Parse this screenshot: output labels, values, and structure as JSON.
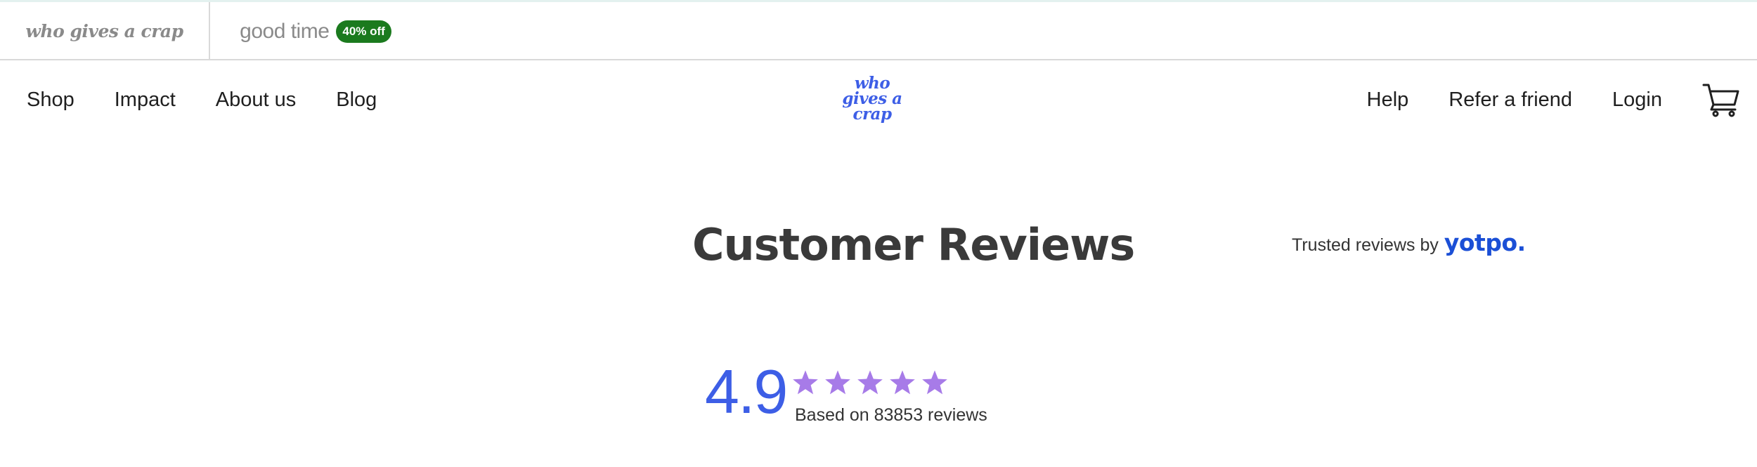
{
  "brand_strip": {
    "tabs": [
      {
        "label": "who gives a crap"
      },
      {
        "label": "good time",
        "badge": "40% off"
      }
    ],
    "badge_color": "#1b7a1e"
  },
  "nav": {
    "left": [
      "Shop",
      "Impact",
      "About us",
      "Blog"
    ],
    "logo": {
      "line1": "who",
      "line2": "gives a",
      "line3": "crap"
    },
    "right": [
      "Help",
      "Refer a friend",
      "Login"
    ],
    "cart_icon": "cart-icon"
  },
  "reviews": {
    "title": "Customer Reviews",
    "trusted_text": "Trusted reviews by",
    "provider": "yotpo.",
    "score": "4.9",
    "stars": 5,
    "based_on": "Based on 83853 reviews"
  },
  "colors": {
    "accent_blue": "#3d5ee6",
    "yotpo_blue": "#1b4fd6",
    "star_purple": "#a77be8",
    "title_gray": "#3a3a3a"
  }
}
